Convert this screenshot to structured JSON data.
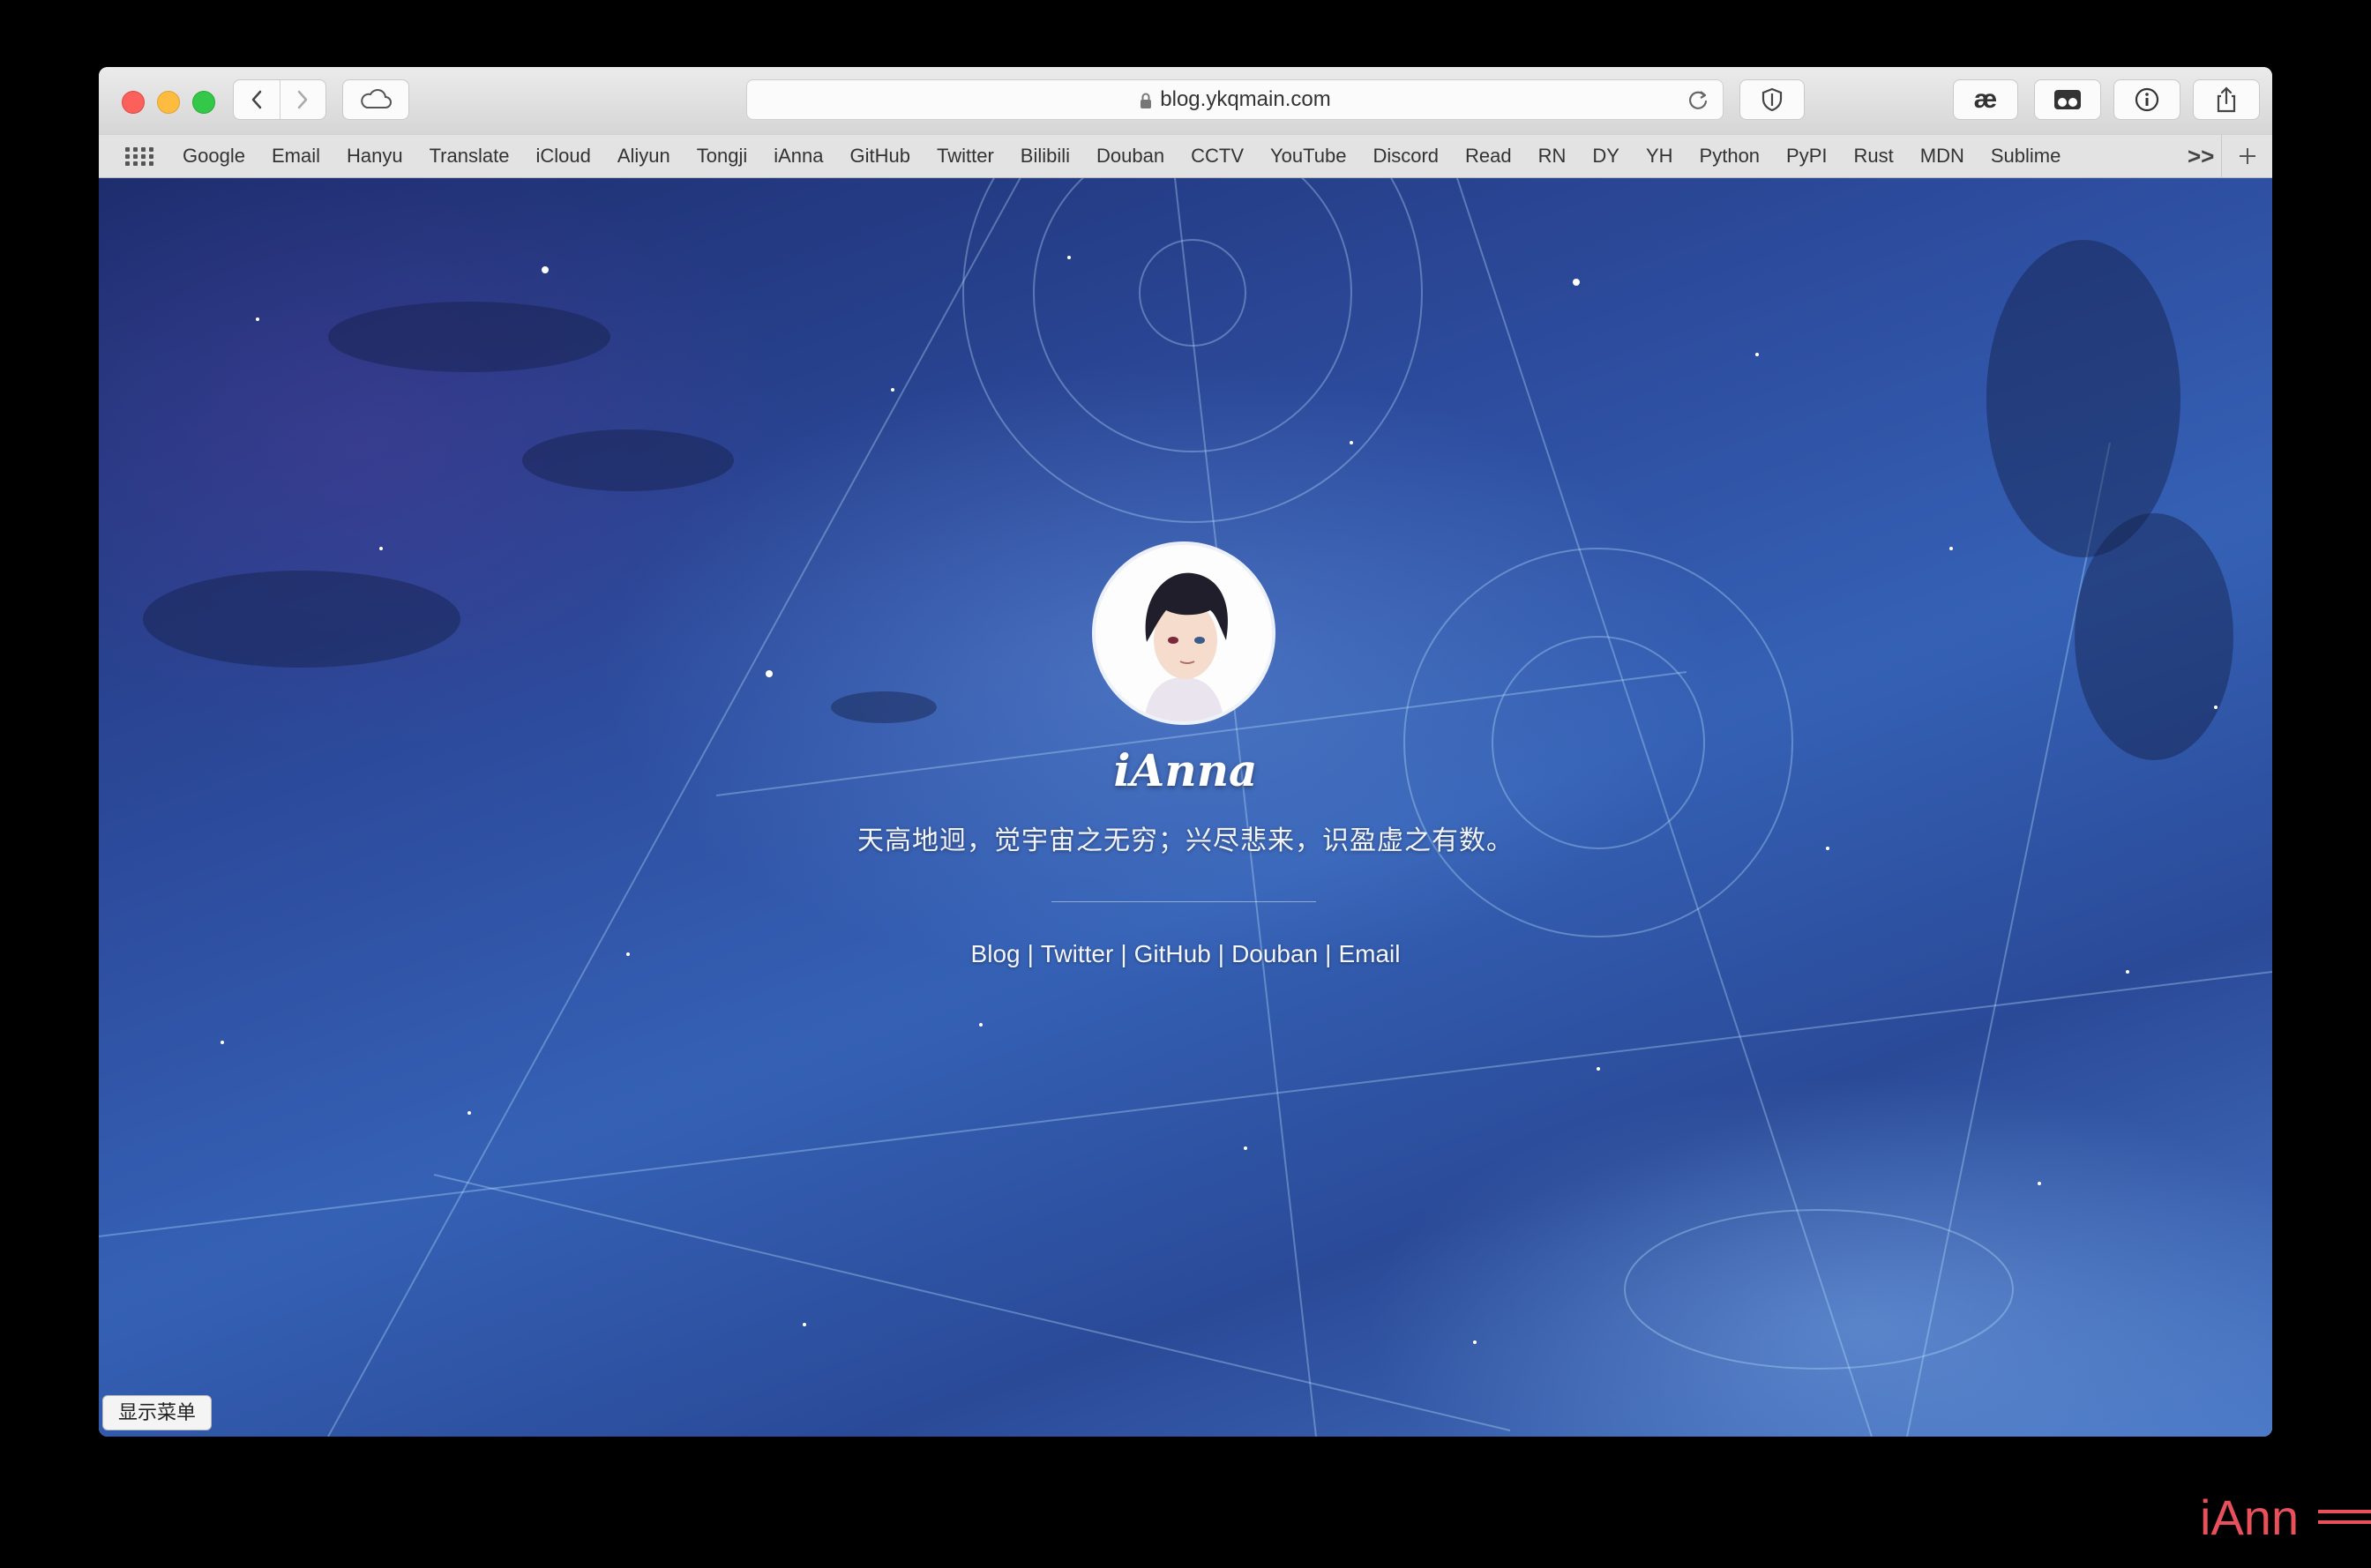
{
  "browser": {
    "url": "blog.ykqmain.com",
    "extension_label": "æ"
  },
  "bookmarks": [
    "Google",
    "Email",
    "Hanyu",
    "Translate",
    "iCloud",
    "Aliyun",
    "Tongji",
    "iAnna",
    "GitHub",
    "Twitter",
    "Bilibili",
    "Douban",
    "CCTV",
    "YouTube",
    "Discord",
    "Read",
    "RN",
    "DY",
    "YH",
    "Python",
    "PyPI",
    "Rust",
    "MDN",
    "Sublime"
  ],
  "bookmarks_overflow": ">>",
  "page": {
    "title": "iAnna",
    "motto": "天高地迥，觉宇宙之无穷；兴尽悲来，识盈虚之有数。",
    "links": {
      "blog": "Blog",
      "twitter": "Twitter",
      "github": "GitHub",
      "douban": "Douban",
      "email": "Email",
      "separator": "|"
    },
    "menu_button": "显示菜单"
  },
  "watermark": "iAnn",
  "colors": {
    "accent_watermark": "#e8505b",
    "sky_dark": "#1d2d6e",
    "sky_light": "#4a78c6"
  }
}
